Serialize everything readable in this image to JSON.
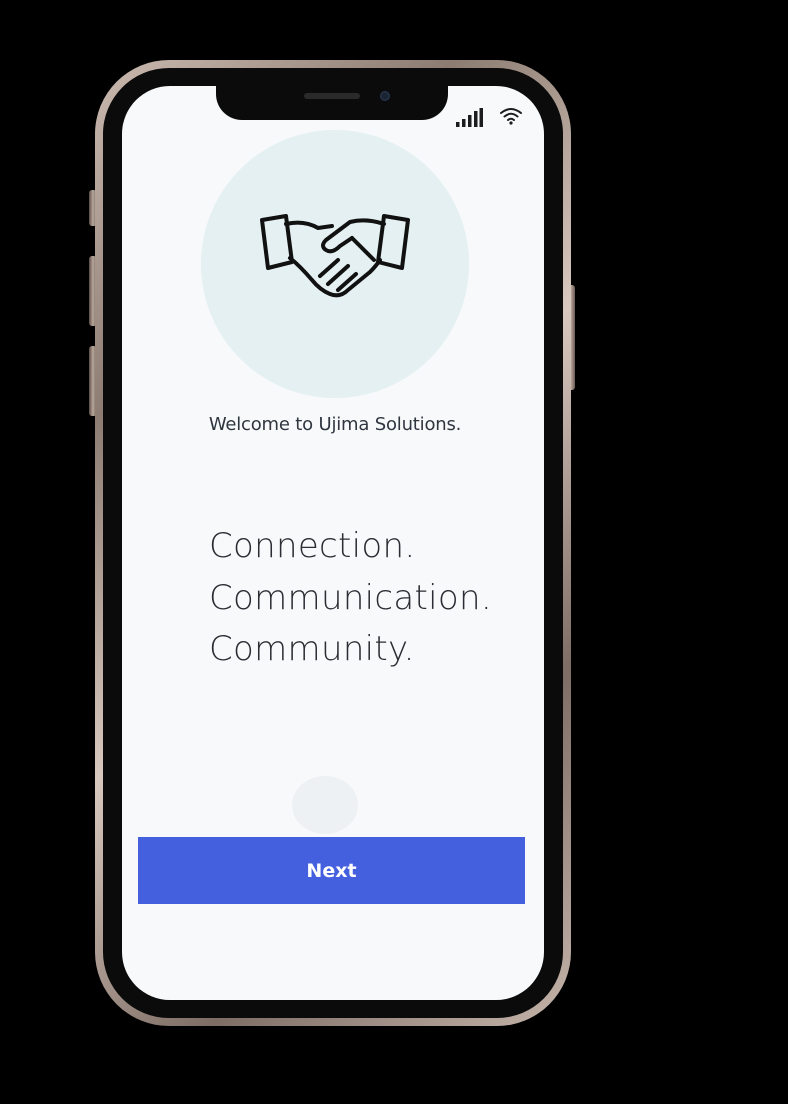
{
  "device": {
    "status_icons": [
      "signal-bars-icon",
      "wifi-icon"
    ]
  },
  "onboarding": {
    "hero_icon": "handshake-icon",
    "welcome_text": "Welcome to Ujima  Solutions.",
    "tagline": [
      "Connection.",
      "Communication.",
      "Community."
    ],
    "next_label": "Next"
  },
  "colors": {
    "accent": "#4560df",
    "hero_circle": "#e4f0f1",
    "screen_background": "#f7f9fa",
    "text_primary": "#2a2d33"
  }
}
